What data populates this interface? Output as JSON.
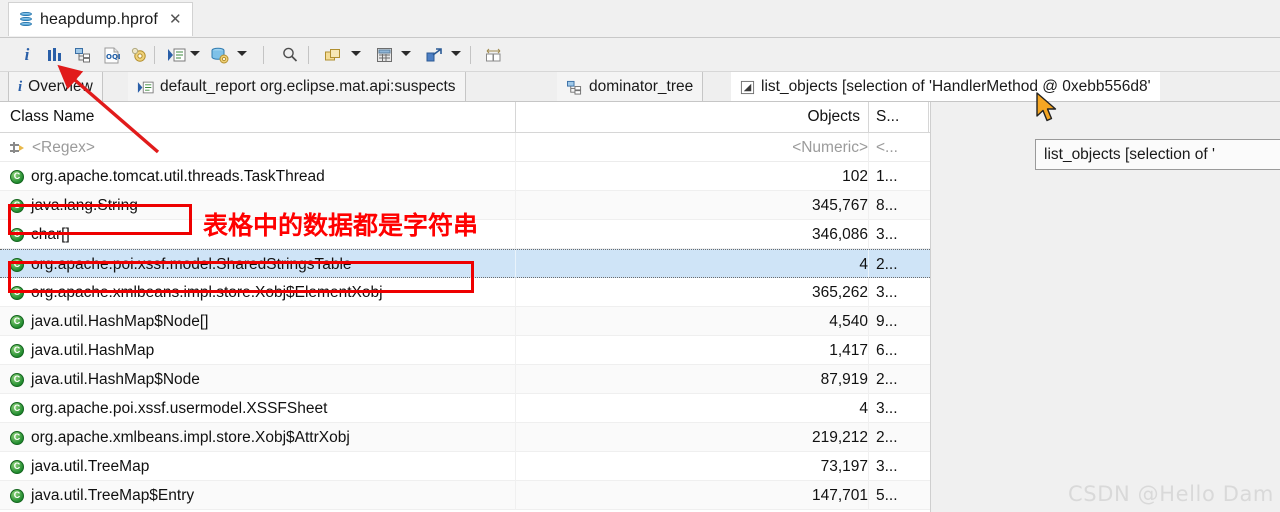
{
  "editor_tab": {
    "title": "heapdump.hprof",
    "close_label": "✕",
    "icon": "heapdump-db-icon"
  },
  "toolbar": {
    "buttons": [
      {
        "name": "overview-info",
        "icon": "info-i-icon",
        "label": "i"
      },
      {
        "name": "histogram",
        "icon": "histogram-bars-icon",
        "label": ""
      },
      {
        "name": "dominator-tree",
        "icon": "dominator-tree-icon",
        "label": ""
      },
      {
        "name": "oql",
        "icon": "oql-icon",
        "label": "OQL"
      },
      {
        "name": "settings",
        "icon": "gear-icon",
        "label": ""
      },
      {
        "name": "run-report",
        "icon": "run-report-icon",
        "label": ""
      },
      {
        "name": "query-browser",
        "icon": "query-browser-db-gear-icon",
        "label": ""
      },
      {
        "name": "search",
        "icon": "search-magnifier-icon",
        "label": ""
      },
      {
        "name": "group-by",
        "icon": "group-by-icon",
        "label": ""
      },
      {
        "name": "calculator",
        "icon": "calculator-icon",
        "label": ""
      },
      {
        "name": "export",
        "icon": "export-arrow-icon",
        "label": ""
      },
      {
        "name": "compare",
        "icon": "compare-panes-icon",
        "label": ""
      }
    ]
  },
  "view_tabs": [
    {
      "name": "overview",
      "label": "Overview",
      "icon": "info-i-icon",
      "active": false
    },
    {
      "name": "default-report",
      "label": "default_report org.eclipse.mat.api:suspects",
      "icon": "report-icon",
      "active": false
    },
    {
      "name": "dominator-tree",
      "label": "dominator_tree",
      "icon": "dominator-tree-icon",
      "active": false
    },
    {
      "name": "list-objects",
      "label": "list_objects  [selection of 'HandlerMethod @ 0xebb556d8'",
      "icon": "list-objects-icon",
      "active": true
    }
  ],
  "table": {
    "columns": [
      {
        "name": "class-name",
        "label": "Class Name"
      },
      {
        "name": "objects",
        "label": "Objects"
      },
      {
        "name": "shallow-heap",
        "label": "S..."
      }
    ],
    "filter_row": {
      "class_name": "<Regex>",
      "objects": "<Numeric>",
      "shallow": "<..."
    },
    "rows": [
      {
        "class_name": "org.apache.tomcat.util.threads.TaskThread",
        "objects": "102",
        "shallow": "1...",
        "selected": false
      },
      {
        "class_name": "java.lang.String",
        "objects": "345,767",
        "shallow": "8...",
        "selected": false
      },
      {
        "class_name": "char[]",
        "objects": "346,086",
        "shallow": "3...",
        "selected": false
      },
      {
        "class_name": "org.apache.poi.xssf.model.SharedStringsTable",
        "objects": "4",
        "shallow": "2...",
        "selected": true
      },
      {
        "class_name": "org.apache.xmlbeans.impl.store.Xobj$ElementXobj",
        "objects": "365,262",
        "shallow": "3...",
        "selected": false
      },
      {
        "class_name": "java.util.HashMap$Node[]",
        "objects": "4,540",
        "shallow": "9...",
        "selected": false
      },
      {
        "class_name": "java.util.HashMap",
        "objects": "1,417",
        "shallow": "6...",
        "selected": false
      },
      {
        "class_name": "java.util.HashMap$Node",
        "objects": "87,919",
        "shallow": "2...",
        "selected": false
      },
      {
        "class_name": "org.apache.poi.xssf.usermodel.XSSFSheet",
        "objects": "4",
        "shallow": "3...",
        "selected": false
      },
      {
        "class_name": "org.apache.xmlbeans.impl.store.Xobj$AttrXobj",
        "objects": "219,212",
        "shallow": "2...",
        "selected": false
      },
      {
        "class_name": "java.util.TreeMap",
        "objects": "73,197",
        "shallow": "3...",
        "selected": false
      },
      {
        "class_name": "java.util.TreeMap$Entry",
        "objects": "147,701",
        "shallow": "5...",
        "selected": false
      }
    ]
  },
  "tooltip": {
    "text": "list_objects  [selection of '"
  },
  "annotations": {
    "note_text": "表格中的数据都是字符串",
    "box_color": "#ee0000",
    "arrow_color": "#e11b1b",
    "boxes": [
      {
        "name": "highlight-java-lang-string"
      },
      {
        "name": "highlight-sharedstringstable"
      }
    ]
  },
  "watermark": {
    "text": "CSDN @Hello Dam"
  }
}
